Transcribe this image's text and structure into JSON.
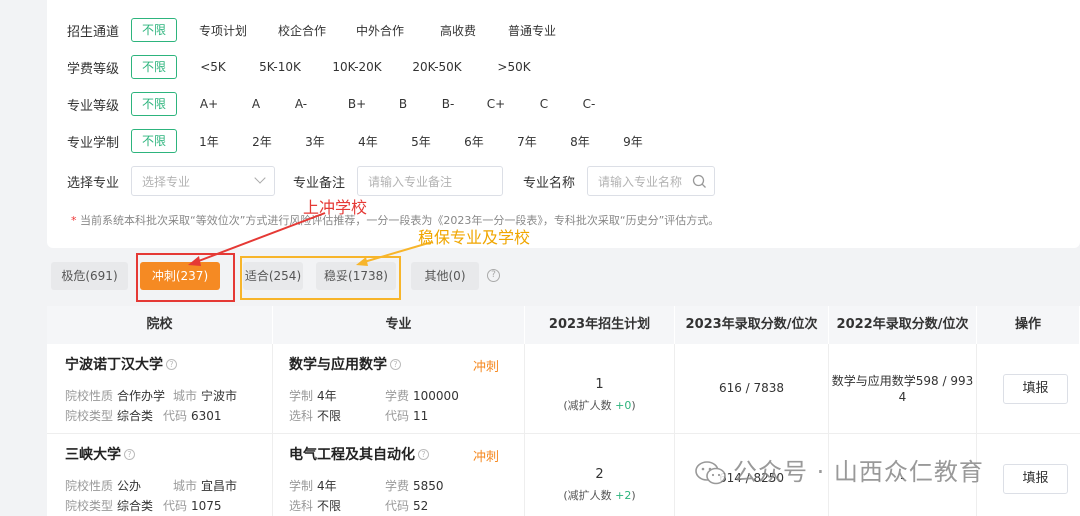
{
  "filters": {
    "channel": {
      "label": "招生通道",
      "options": [
        "不限",
        "专项计划",
        "校企合作",
        "中外合作",
        "高收费",
        "普通专业"
      ]
    },
    "fee": {
      "label": "学费等级",
      "options": [
        "不限",
        "<5K",
        "5K-10K",
        "10K-20K",
        "20K-50K",
        ">50K"
      ]
    },
    "grade": {
      "label": "专业等级",
      "options": [
        "不限",
        "A+",
        "A",
        "A-",
        "B+",
        "B",
        "B-",
        "C+",
        "C",
        "C-"
      ]
    },
    "duration": {
      "label": "专业学制",
      "options": [
        "不限",
        "1年",
        "2年",
        "3年",
        "4年",
        "5年",
        "6年",
        "7年",
        "8年",
        "9年"
      ]
    },
    "select_major": {
      "label": "选择专业",
      "placeholder": "选择专业"
    },
    "major_note": {
      "label": "专业备注",
      "placeholder": "请输入专业备注"
    },
    "major_name": {
      "label": "专业名称",
      "placeholder": "请输入专业名称"
    },
    "note_star": "*",
    "note": "当前系统本科批次采取“等效位次”方式进行风险评估推荐，一分一段表为《2023年一分一段表》，专科批次采取“历史分”评估方式。"
  },
  "annotations": {
    "red": "上冲学校",
    "yellow": "稳保专业及学校"
  },
  "tabs": [
    "极危(691)",
    "冲刺(237)",
    "适合(254)",
    "稳妥(1738)",
    "其他(0)"
  ],
  "tab_help": "?",
  "table": {
    "headers": [
      "院校",
      "专业",
      "2023年招生计划",
      "2023年录取分数/位次",
      "2022年录取分数/位次",
      "操作"
    ],
    "rows": [
      {
        "school": "宁波诺丁汉大学",
        "k_nature": "院校性质",
        "nature": "合作办学",
        "k_city": "城市",
        "city": "宁波市",
        "k_type": "院校类型",
        "type": "综合类",
        "k_code": "代码",
        "code": "6301",
        "major": "数学与应用数学",
        "tag": "冲刺",
        "k_years": "学制",
        "years": "4年",
        "k_fee": "学费",
        "fee": "100000",
        "k_subj": "选科",
        "subj": "不限",
        "k_mcode": "代码",
        "mcode": "11",
        "plan": "1",
        "plan_sub": "(减扩人数",
        "plan_delta": "+0",
        "plan_close": ")",
        "score2023": "616 / 7838",
        "score2022_line1": "数学与应用数学598 / 993",
        "score2022_line2": "4",
        "action": "填报"
      },
      {
        "school": "三峡大学",
        "k_nature": "院校性质",
        "nature": "公办",
        "k_city": "城市",
        "city": "宜昌市",
        "k_type": "院校类型",
        "type": "综合类",
        "k_code": "代码",
        "code": "1075",
        "major": "电气工程及其自动化",
        "tag": "冲刺",
        "k_years": "学制",
        "years": "4年",
        "k_fee": "学费",
        "fee": "5850",
        "k_subj": "选科",
        "subj": "不限",
        "k_mcode": "代码",
        "mcode": "52",
        "plan": "2",
        "plan_sub": "(减扩人数",
        "plan_delta": "+2",
        "plan_close": ")",
        "score2023": "614 / 8250",
        "score2022_line1": "-",
        "score2022_line2": "",
        "action": "填报"
      }
    ]
  },
  "watermark": "公众号 · 山西众仁教育",
  "colors": {
    "accent_green": "#2db47d",
    "accent_orange": "#f58a23",
    "annotation_red": "#e53935",
    "annotation_yellow": "#f7b52b"
  }
}
